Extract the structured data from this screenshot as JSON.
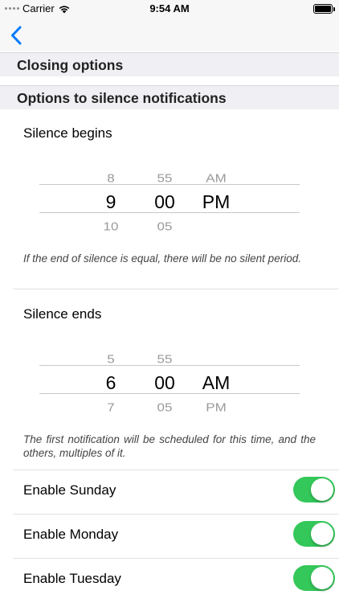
{
  "status_bar": {
    "carrier": "Carrier",
    "time": "9:54 AM",
    "battery_level": 1.0
  },
  "nav": {
    "back_icon": "chevron-left-icon",
    "accent_color": "#007aff"
  },
  "sections": {
    "closing_options": "Closing options",
    "silence_options": "Options to silence notifications"
  },
  "silence_begins": {
    "label": "Silence begins",
    "picker": {
      "hour": {
        "faint_top": "",
        "prev": "8",
        "selected": "9",
        "next": "10",
        "faint_bottom": ""
      },
      "minute": {
        "faint_top": "",
        "prev": "55",
        "selected": "00",
        "next": "05",
        "faint_bottom": ""
      },
      "period": {
        "prev": "AM",
        "selected": "PM",
        "next": ""
      }
    },
    "note": "If the end of silence is equal, there will be no silent period."
  },
  "silence_ends": {
    "label": "Silence ends",
    "picker": {
      "hour": {
        "faint_top": "",
        "prev": "5",
        "selected": "6",
        "next": "7",
        "faint_bottom": ""
      },
      "minute": {
        "faint_top": "",
        "prev": "55",
        "selected": "00",
        "next": "05",
        "faint_bottom": ""
      },
      "period": {
        "prev": "",
        "selected": "AM",
        "next": "PM"
      }
    },
    "note": "The first notification will be scheduled for this time, and the others, multiples of it."
  },
  "day_toggles": [
    {
      "label": "Enable Sunday",
      "on": true
    },
    {
      "label": "Enable Monday",
      "on": true
    },
    {
      "label": "Enable Tuesday",
      "on": true
    }
  ],
  "toggle_on_color": "#34c759"
}
